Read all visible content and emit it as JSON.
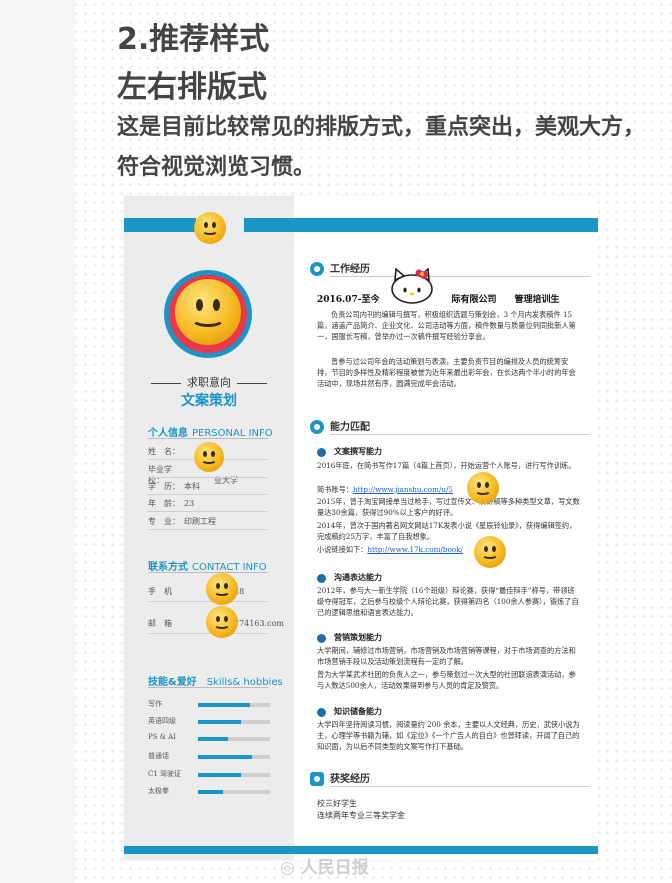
{
  "header": {
    "title": "2.推荐样式",
    "subtitle": "左右排版式",
    "intro": "这是目前比较常见的排版方式，重点突出，美观大方，符合视觉浏览习惯。"
  },
  "resume": {
    "objective_label": "求职意向",
    "objective_value": "文案策划",
    "personal": {
      "heading": "个人信息",
      "heading_en": "PERSONAL INFO",
      "rows": [
        {
          "k": "姓　名：",
          "v": ""
        },
        {
          "k": "毕业学校：",
          "v": "业大学"
        },
        {
          "k": "学　历：",
          "v": "本科"
        },
        {
          "k": "年　龄：",
          "v": "23"
        },
        {
          "k": "专　业：",
          "v": "印刷工程"
        }
      ]
    },
    "contact": {
      "heading": "联系方式",
      "heading_en": "CONTACT INFO",
      "rows": [
        {
          "k": "手　机",
          "v": "28"
        },
        {
          "k": "邮　箱",
          "v": "774163.com"
        }
      ]
    },
    "skills": {
      "heading": "技能&爱好",
      "heading_en": "Skills& hobbies",
      "items": [
        {
          "name": "写作",
          "level": 0.72
        },
        {
          "name": "英语四级",
          "level": 0.6
        },
        {
          "name": "PS & AI",
          "level": 0.42
        },
        {
          "name": "普通话",
          "level": 0.75
        },
        {
          "name": "C1 驾驶证",
          "level": 0.6
        },
        {
          "name": "太极拳",
          "level": 0.35
        }
      ]
    },
    "work": {
      "heading": "工作经历",
      "job_date": "2016.07-至今",
      "job_company": "际有限公司",
      "job_title": "管理培训生",
      "p1": "负责公司内刊的编辑与撰写，积极组织选题与策划会，3 个月内发表稿件 15 篇，涵盖产品简介、企业文化、公司活动等方面，稿件数量与质量位列同批新人第一，国服长写稿，曾举办过一次稿件撰写经验分享会。",
      "p2": "曾参与过公司年会的活动策划与表演，主要负责节目的编排及人员的统筹安排，节目的多样性及精彩程度被誉为近年来最出彩年会，在长达两个半小时的年会活动中，现场井然有序，圆满完成年会活动。"
    },
    "ability": {
      "heading": "能力匹配",
      "s1": {
        "title": "文案撰写能力",
        "t1": "2016年底，在简书写作17篇（4篇上首页），开始运营个人账号，进行写作训练。",
        "link1_label": "简书账号：",
        "link1": "http://www.jianshu.com/u/5",
        "link1_tail": "fe",
        "t2": "2015年，曾于淘宝网接单当过枪手，写过宣传文、演讲稿等多种类型文章，写文数量达30余篇，获得过90%以上客户的好评。",
        "t3": "2014年，曾次于国内著名网文网站17K发表小说《星辰铃仙录》，获得编辑签约，完成稿约25万字，丰富了自我想象。",
        "link2_label": "小说链接如下：",
        "link2": "http://www.17k.com/book/",
        "link2_tail": "tml"
      },
      "s2": {
        "title": "沟通表达能力",
        "t1": "2012年，参与大一新生学院（16个班级）辩论赛，获得“最佳辩手”称号，带领班级夺得冠军，之后参与校级个人辩论比赛，获得第四名（100余人参赛），锻炼了自己的逻辑思维和语言表达能力。"
      },
      "s3": {
        "title": "营销策划能力",
        "t1": "大学期间，辅修过市场营销，市场营销及市场营销等课程，对于市场调查的方法和市场营销手段以及活动策划流程有一定的了解。",
        "t2": "曾为大学某武术社团的负责人之一，参与策划过一次大型的社团联谊表演活动，参与人数达500余人，活动效果得到参与人员的肯定及赞赏。"
      },
      "s4": {
        "title": "知识储备能力",
        "t1": "大学四年坚持阅读习惯，阅读量约 200 余本，主要以人文经典，历史，武侠小说为主，心理学等书籍为辅，如《定位》《一个广告人的自白》也曾拜读，开阔了自己的知识面，为以后不同类型的文案写作打下基础。"
      }
    },
    "awards": {
      "heading": "获奖经历",
      "a1": "校三好学生",
      "a2": "连续两年专业三等奖学金"
    }
  },
  "watermark": "人民日报",
  "colors": {
    "accent": "#1b95c5",
    "sidebar": "#ececec"
  }
}
